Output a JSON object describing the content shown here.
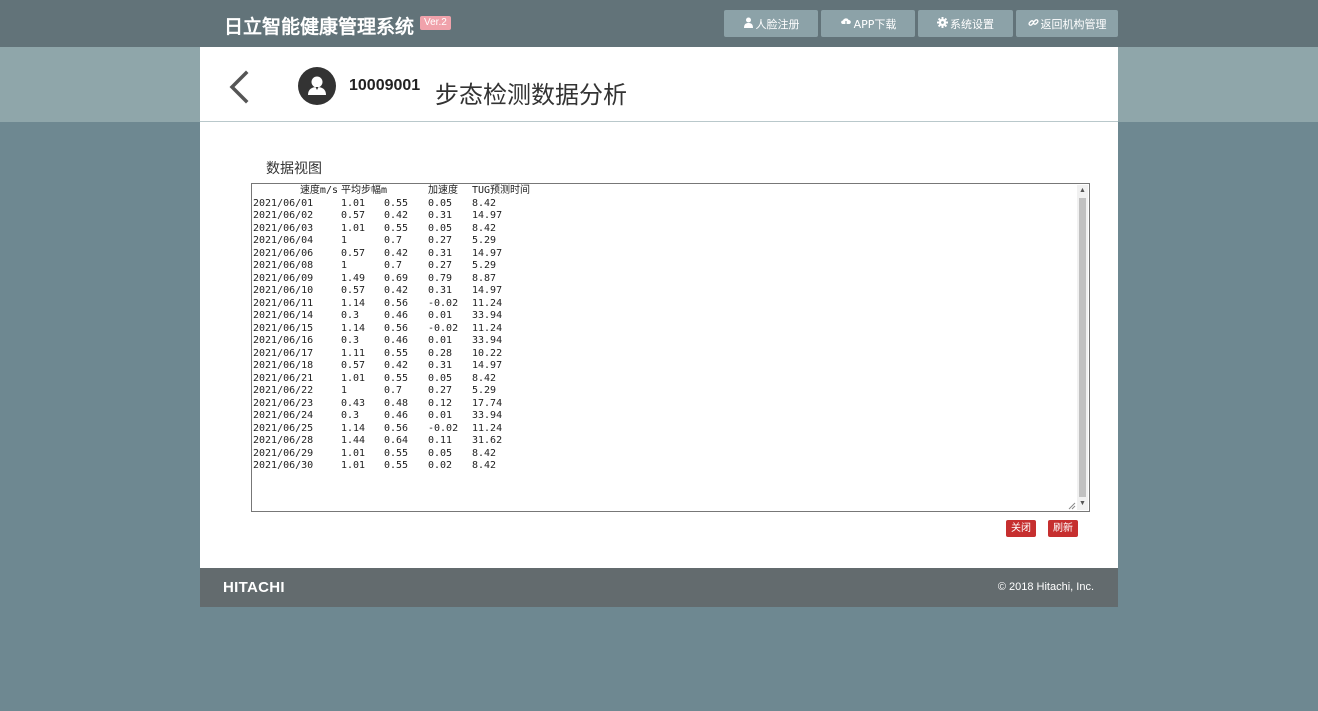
{
  "header": {
    "brand": "日立智能健康管理系统",
    "version": "Ver.2",
    "nav": [
      {
        "icon": "user-icon",
        "label": "人脸注册"
      },
      {
        "icon": "cloud-download-icon",
        "label": "APP下载"
      },
      {
        "icon": "gear-icon",
        "label": "系统设置"
      },
      {
        "icon": "link-icon",
        "label": "返回机构管理"
      }
    ]
  },
  "page": {
    "user_id": "10009001",
    "title": "步态检测数据分析",
    "section_label": "数据视图"
  },
  "table": {
    "headers": [
      "速度m/s",
      "平均步幅m",
      "",
      "加速度",
      "TUG预测时间"
    ],
    "rows": [
      [
        "2021/06/01",
        "1.01",
        "0.55",
        "0.05",
        "8.42"
      ],
      [
        "2021/06/02",
        "0.57",
        "0.42",
        "0.31",
        "14.97"
      ],
      [
        "2021/06/03",
        "1.01",
        "0.55",
        "0.05",
        "8.42"
      ],
      [
        "2021/06/04",
        "1",
        "0.7",
        "0.27",
        "5.29"
      ],
      [
        "2021/06/06",
        "0.57",
        "0.42",
        "0.31",
        "14.97"
      ],
      [
        "2021/06/08",
        "1",
        "0.7",
        "0.27",
        "5.29"
      ],
      [
        "2021/06/09",
        "1.49",
        "0.69",
        "0.79",
        "8.87"
      ],
      [
        "2021/06/10",
        "0.57",
        "0.42",
        "0.31",
        "14.97"
      ],
      [
        "2021/06/11",
        "1.14",
        "0.56",
        "-0.02",
        "11.24"
      ],
      [
        "2021/06/14",
        "0.3",
        "0.46",
        "0.01",
        "33.94"
      ],
      [
        "2021/06/15",
        "1.14",
        "0.56",
        "-0.02",
        "11.24"
      ],
      [
        "2021/06/16",
        "0.3",
        "0.46",
        "0.01",
        "33.94"
      ],
      [
        "2021/06/17",
        "1.11",
        "0.55",
        "0.28",
        "10.22"
      ],
      [
        "2021/06/18",
        "0.57",
        "0.42",
        "0.31",
        "14.97"
      ],
      [
        "2021/06/21",
        "1.01",
        "0.55",
        "0.05",
        "8.42"
      ],
      [
        "2021/06/22",
        "1",
        "0.7",
        "0.27",
        "5.29"
      ],
      [
        "2021/06/23",
        "0.43",
        "0.48",
        "0.12",
        "17.74"
      ],
      [
        "2021/06/24",
        "0.3",
        "0.46",
        "0.01",
        "33.94"
      ],
      [
        "2021/06/25",
        "1.14",
        "0.56",
        "-0.02",
        "11.24"
      ],
      [
        "2021/06/28",
        "1.44",
        "0.64",
        "0.11",
        "31.62"
      ],
      [
        "2021/06/29",
        "1.01",
        "0.55",
        "0.05",
        "8.42"
      ],
      [
        "2021/06/30",
        "1.01",
        "0.55",
        "0.02",
        "8.42"
      ]
    ]
  },
  "actions": {
    "close": "关闭",
    "refresh": "刷新"
  },
  "footer": {
    "logo": "HITACHI",
    "copyright": "© 2018 Hitachi, Inc."
  }
}
